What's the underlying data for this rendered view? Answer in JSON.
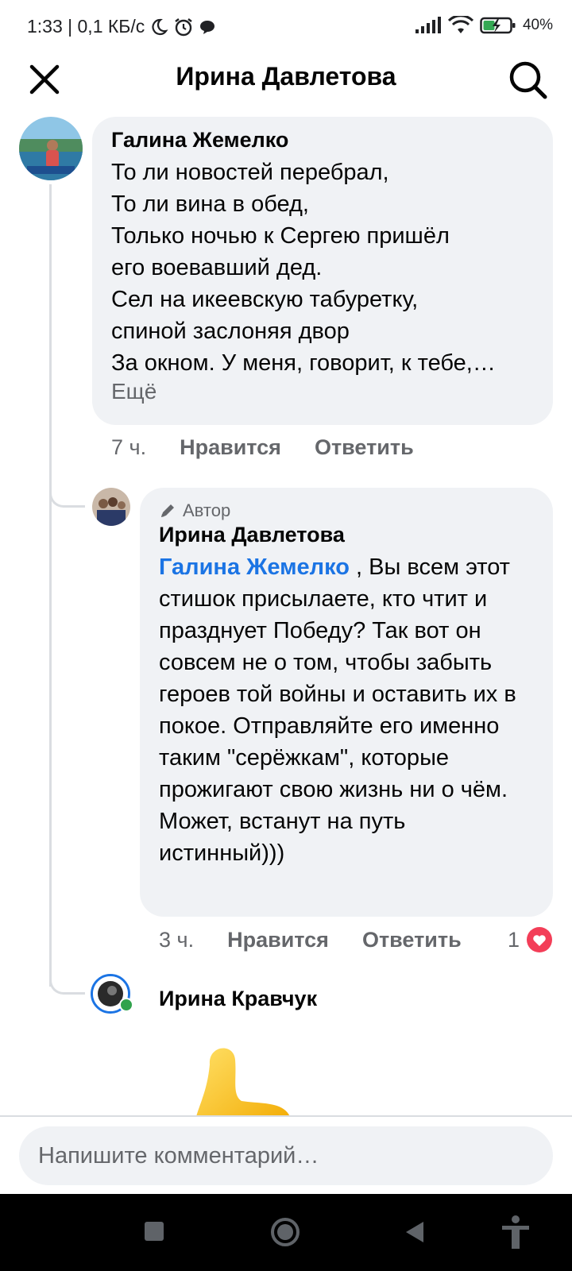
{
  "status_bar": {
    "time_info": "1:33 | 0,1 КБ/с",
    "battery": "40"
  },
  "header": {
    "title": "Ирина Давлетова"
  },
  "comments": [
    {
      "author": "Галина Жемелко",
      "text": "То ли новостей перебрал,\nТо ли вина в обед,\nТолько ночью к Сергею пришёл\nего воевавший дед.\nСел на икеевскую табуретку,\nспиной заслоняя двор\nЗа окном. У меня, говорит, к тебе,…",
      "more_label": "Ещё",
      "time": "7 ч.",
      "like_label": "Нравится",
      "reply_label": "Ответить"
    },
    {
      "badge": "Автор",
      "author": "Ирина Давлетова",
      "mention": "Галина Жемелко",
      "text": " , Вы всем этот стишок присылаете, кто чтит и празднует Победу? Так вот он совсем не о том, чтобы забыть героев той войны и оставить их в покое. Отправляйте его именно таким \"серёжкам\", которые прожигают свою жизнь ни о чём. Может, встанут на путь истинный)))",
      "time": "3 ч.",
      "like_label": "Нравится",
      "reply_label": "Ответить",
      "reaction_count": "1"
    },
    {
      "author": "Ирина Кравчук"
    }
  ],
  "composer": {
    "placeholder": "Напишите комментарий…"
  },
  "colors": {
    "mention_blue": "#1b74e4",
    "bubble_bg": "#f0f2f5",
    "secondary_text": "#65676b",
    "heart_red": "#f33e58",
    "online_green": "#31a24c"
  }
}
